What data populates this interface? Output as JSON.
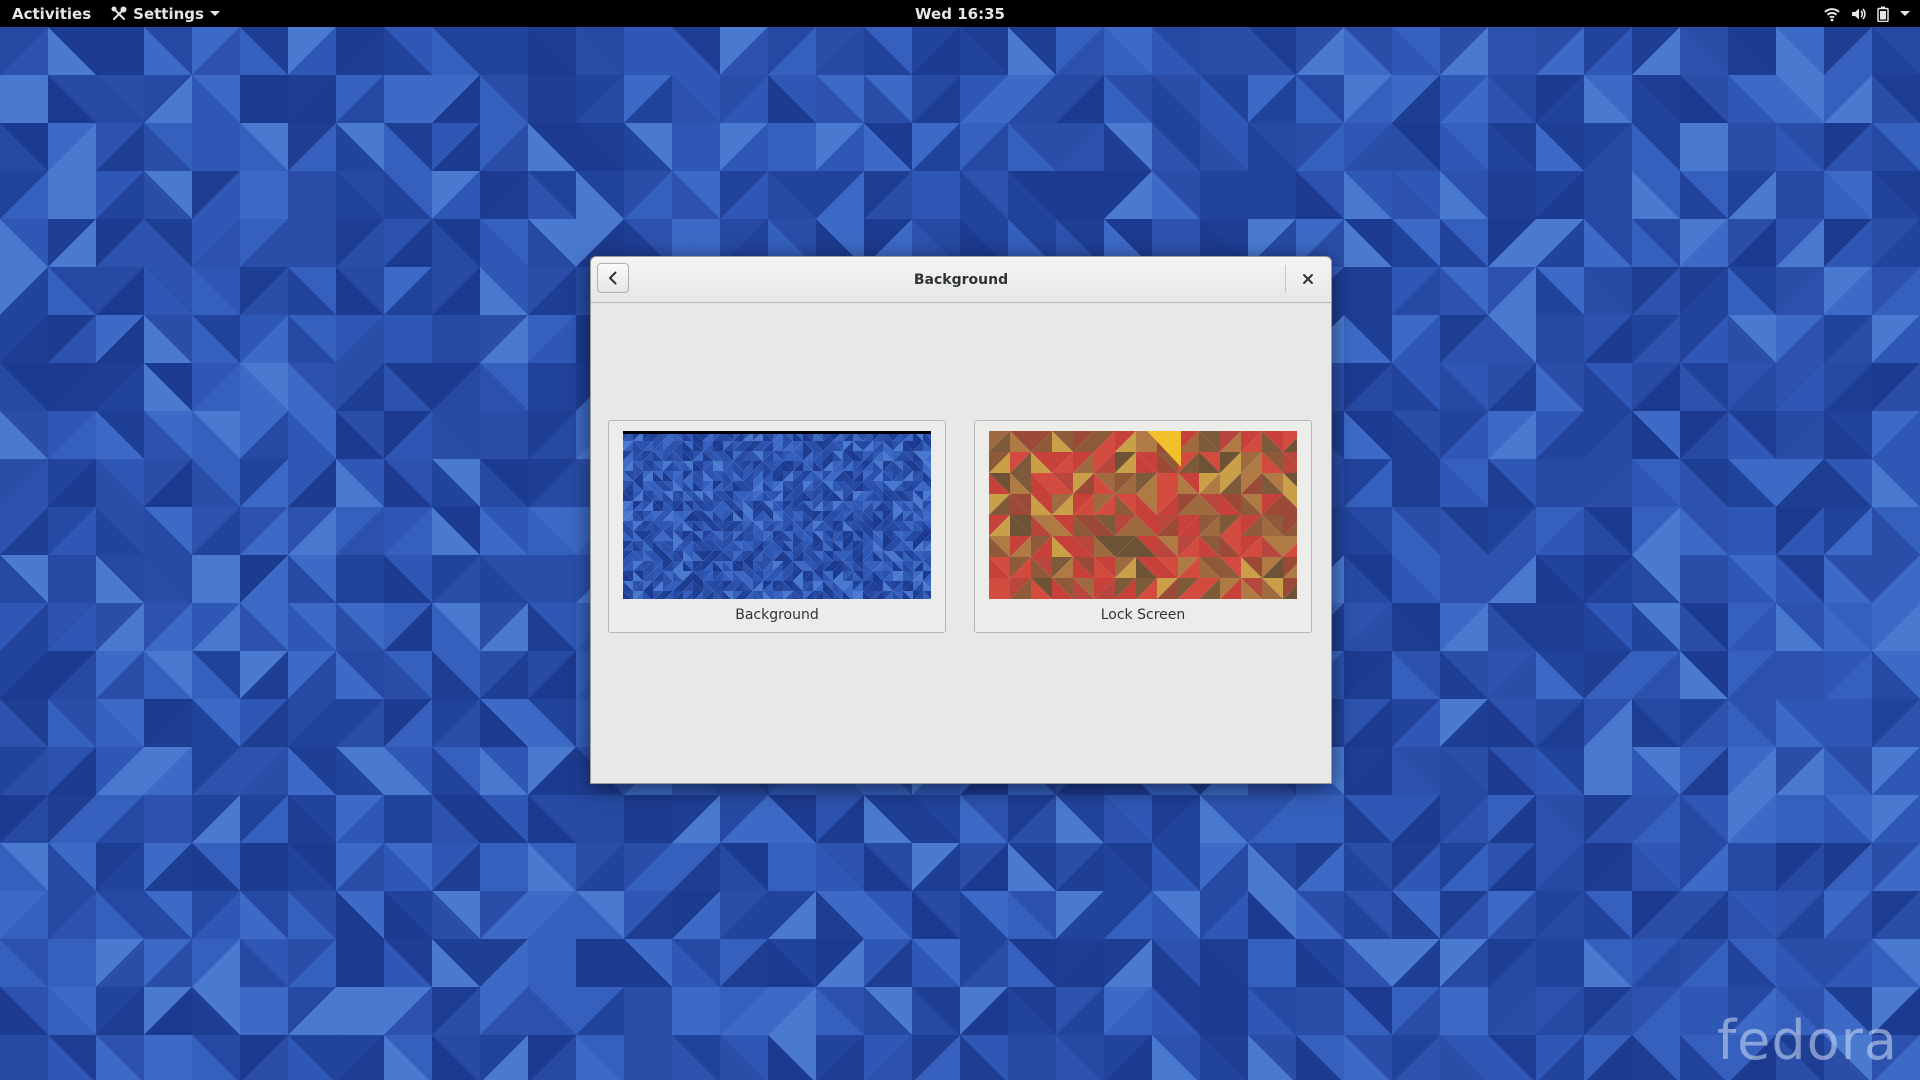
{
  "topbar": {
    "activities": "Activities",
    "app_menu_label": "Settings",
    "clock": "Wed 16:35",
    "status_icons": [
      "wifi-icon",
      "volume-icon",
      "battery-icon",
      "system-menu-arrow-icon"
    ]
  },
  "dialog": {
    "title": "Background",
    "back_icon": "chevron-left-icon",
    "close_icon": "close-icon",
    "options": [
      {
        "label": "Background"
      },
      {
        "label": "Lock Screen"
      }
    ]
  },
  "desktop": {
    "watermark": "fedora"
  },
  "colors": {
    "wallpaper_blue": "#2a4ea8",
    "topbar": "#000000",
    "dialog_bg": "#e8e8e7",
    "lockscreen_red": "#c8403a"
  }
}
